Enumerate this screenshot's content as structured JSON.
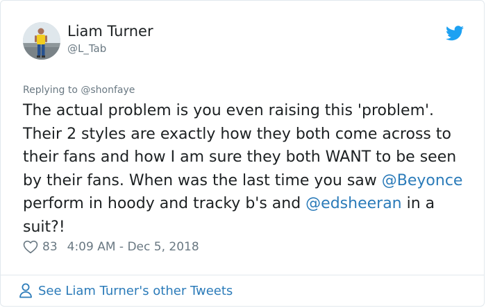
{
  "author": {
    "name": "Liam Turner",
    "handle": "@L_Tab",
    "avatar_icon": "avatar-photo"
  },
  "reply": {
    "prefix": "Replying to ",
    "to": "@shonfaye"
  },
  "tweet": {
    "text_1": "The actual problem is you even raising this 'problem'. Their 2 styles are exactly how they both come across to their fans and how I am sure they both WANT to be seen by their fans. When was the last time you saw ",
    "mention_1": "@Beyonce",
    "text_2": " perform in hoody and tracky b's and ",
    "mention_2": "@edsheeran",
    "text_3": " in a suit?!"
  },
  "meta": {
    "likes": "83",
    "timestamp": "4:09 AM - Dec 5, 2018",
    "heart_icon": "heart-outline-icon"
  },
  "footer": {
    "link_label": "See Liam Turner's other Tweets",
    "icon": "person-outline-icon"
  },
  "colors": {
    "link": "#2b7bb9",
    "secondary": "#697882",
    "twitter_blue": "#1da1f2",
    "border": "#e1e8ed"
  }
}
